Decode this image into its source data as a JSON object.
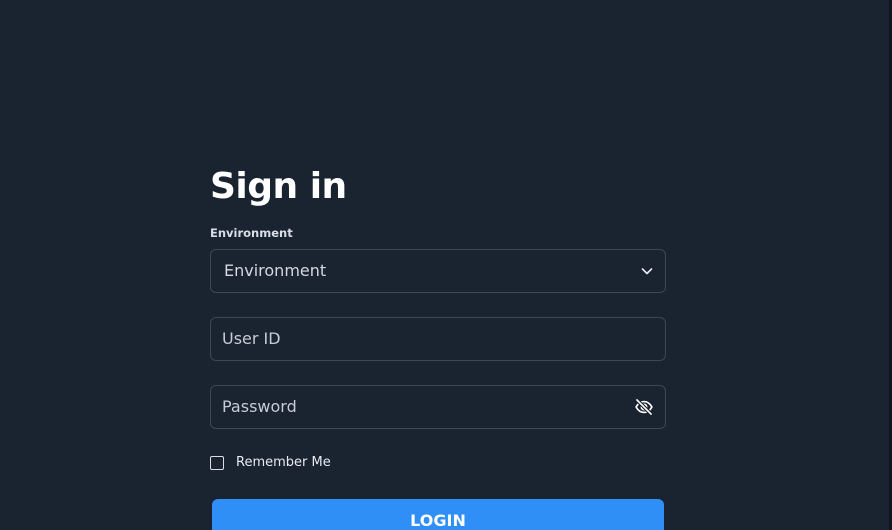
{
  "signin": {
    "title": "Sign in",
    "environment_label": "Environment",
    "environment_select": {
      "selected": "Environment"
    },
    "user_id_placeholder": "User ID",
    "password_placeholder": "Password",
    "password_toggle_icon": "eye-off-icon",
    "remember_me_label": "Remember Me",
    "remember_me_checked": false,
    "login_label": "LOGIN"
  },
  "colors": {
    "background": "#1a2330",
    "field_border": "#3a4757",
    "primary_button": "#2f8ff7",
    "text": "#ffffff"
  }
}
